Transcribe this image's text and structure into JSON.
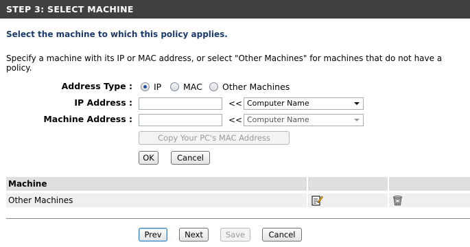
{
  "header": {
    "title": "STEP 3: SELECT MACHINE"
  },
  "subtitle": "Select the machine to which this policy applies.",
  "description": "Specify a machine with its IP or MAC address, or select \"Other Machines\" for machines that do not have a policy.",
  "form": {
    "address_type_label": "Address Type :",
    "address_type_options": [
      "IP",
      "MAC",
      "Other Machines"
    ],
    "address_type_selected": "IP",
    "ip_label": "IP Address :",
    "ip_value": "",
    "mac_label": "Machine Address :",
    "mac_value": "",
    "arrows": "<<",
    "ip_select_value": "Computer Name",
    "mac_select_value": "Computer Name",
    "copy_mac_label": "Copy Your PC's MAC Address",
    "ok_label": "OK",
    "cancel_label": "Cancel"
  },
  "table": {
    "header": "Machine",
    "rows": [
      {
        "machine": "Other Machines"
      }
    ],
    "edit_icon": "edit-icon",
    "delete_icon": "trash-icon"
  },
  "footer": {
    "prev_label": "Prev",
    "next_label": "Next",
    "save_label": "Save",
    "cancel_label": "Cancel"
  }
}
